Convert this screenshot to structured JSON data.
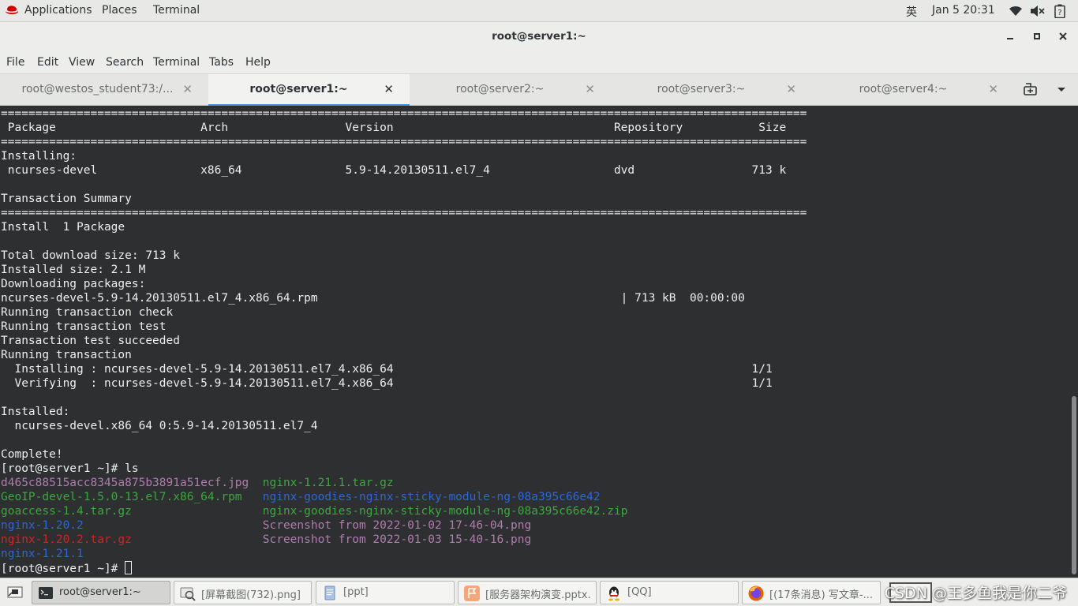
{
  "topbar": {
    "applications": "Applications",
    "places": "Places",
    "terminal": "Terminal",
    "input_method": "英",
    "clock": "Jan 5  20:31"
  },
  "window": {
    "title": "root@server1:~"
  },
  "menu": [
    "File",
    "Edit",
    "View",
    "Search",
    "Terminal",
    "Tabs",
    "Help"
  ],
  "tabs": [
    {
      "label": "root@westos_student73:/...",
      "active": false
    },
    {
      "label": "root@server1:~",
      "active": true
    },
    {
      "label": "root@server2:~",
      "active": false
    },
    {
      "label": "root@server3:~",
      "active": false
    },
    {
      "label": "root@server4:~",
      "active": false
    }
  ],
  "terminal": {
    "lines": [
      [
        {
          "t": "=====================================================================================================================",
          "c": "def"
        }
      ],
      [
        {
          "t": " Package                     Arch                 Version                                Repository           Size",
          "c": "def"
        }
      ],
      [
        {
          "t": "=====================================================================================================================",
          "c": "def"
        }
      ],
      [
        {
          "t": "Installing:",
          "c": "def"
        }
      ],
      [
        {
          "t": " ncurses-devel               x86_64               5.9-14.20130511.el7_4                  dvd                 713 k",
          "c": "def"
        }
      ],
      [
        {
          "t": "",
          "c": "def"
        }
      ],
      [
        {
          "t": "Transaction Summary",
          "c": "def"
        }
      ],
      [
        {
          "t": "=====================================================================================================================",
          "c": "def"
        }
      ],
      [
        {
          "t": "Install  1 Package",
          "c": "def"
        }
      ],
      [
        {
          "t": "",
          "c": "def"
        }
      ],
      [
        {
          "t": "Total download size: 713 k",
          "c": "def"
        }
      ],
      [
        {
          "t": "Installed size: 2.1 M",
          "c": "def"
        }
      ],
      [
        {
          "t": "Downloading packages:",
          "c": "def"
        }
      ],
      [
        {
          "t": "ncurses-devel-5.9-14.20130511.el7_4.x86_64.rpm                                            | 713 kB  00:00:00",
          "c": "def"
        }
      ],
      [
        {
          "t": "Running transaction check",
          "c": "def"
        }
      ],
      [
        {
          "t": "Running transaction test",
          "c": "def"
        }
      ],
      [
        {
          "t": "Transaction test succeeded",
          "c": "def"
        }
      ],
      [
        {
          "t": "Running transaction",
          "c": "def"
        }
      ],
      [
        {
          "t": "  Installing : ncurses-devel-5.9-14.20130511.el7_4.x86_64                                                    1/1",
          "c": "def"
        }
      ],
      [
        {
          "t": "  Verifying  : ncurses-devel-5.9-14.20130511.el7_4.x86_64                                                    1/1",
          "c": "def"
        }
      ],
      [
        {
          "t": "",
          "c": "def"
        }
      ],
      [
        {
          "t": "Installed:",
          "c": "def"
        }
      ],
      [
        {
          "t": "  ncurses-devel.x86_64 0:5.9-14.20130511.el7_4",
          "c": "def"
        }
      ],
      [
        {
          "t": "",
          "c": "def"
        }
      ],
      [
        {
          "t": "Complete!",
          "c": "def"
        }
      ],
      [
        {
          "t": "[root@server1 ~]# ls",
          "c": "def"
        }
      ],
      [
        {
          "t": "d465c88515acc8345a875b3891a51ecf.jpg",
          "c": "mag"
        },
        {
          "t": "  ",
          "c": "def"
        },
        {
          "t": "nginx-1.21.1.tar.gz",
          "c": "grn"
        }
      ],
      [
        {
          "t": "GeoIP-devel-1.5.0-13.el7.x86_64.rpm",
          "c": "grn"
        },
        {
          "t": "   ",
          "c": "def"
        },
        {
          "t": "nginx-goodies-nginx-sticky-module-ng-08a395c66e42",
          "c": "blu"
        }
      ],
      [
        {
          "t": "goaccess-1.4.tar.gz",
          "c": "grn"
        },
        {
          "t": "                   ",
          "c": "def"
        },
        {
          "t": "nginx-goodies-nginx-sticky-module-ng-08a395c66e42.zip",
          "c": "grn"
        }
      ],
      [
        {
          "t": "nginx-1.20.2",
          "c": "blu"
        },
        {
          "t": "                          ",
          "c": "def"
        },
        {
          "t": "Screenshot from 2022-01-02 17-46-04.png",
          "c": "mag"
        }
      ],
      [
        {
          "t": "nginx-1.20.2.tar.gz",
          "c": "red"
        },
        {
          "t": "                   ",
          "c": "def"
        },
        {
          "t": "Screenshot from 2022-01-03 15-40-16.png",
          "c": "mag"
        }
      ],
      [
        {
          "t": "nginx-1.21.1",
          "c": "blu"
        }
      ],
      [
        {
          "t": "[root@server1 ~]# ",
          "c": "def"
        }
      ]
    ],
    "colors": {
      "def": "#eeeeec",
      "mag": "#b07cae",
      "grn": "#3ea641",
      "blu": "#2c66d8",
      "red": "#d22323"
    }
  },
  "taskbar": {
    "items": [
      {
        "label": "root@server1:~",
        "icon": "terminal-icon",
        "active": true
      },
      {
        "label": "[屏幕截图(732).png]",
        "icon": "image-viewer-icon",
        "active": false
      },
      {
        "label": "[ppt]",
        "icon": "document-icon",
        "active": false
      },
      {
        "label": "[服务器架构演变.pptx...",
        "icon": "presentation-icon",
        "active": false
      },
      {
        "label": "[QQ]",
        "icon": "qq-icon",
        "active": false
      },
      {
        "label": "[(17条消息) 写文章-...",
        "icon": "firefox-icon",
        "active": false
      }
    ],
    "watermark": "CSDN @王多鱼我是你二爷"
  }
}
